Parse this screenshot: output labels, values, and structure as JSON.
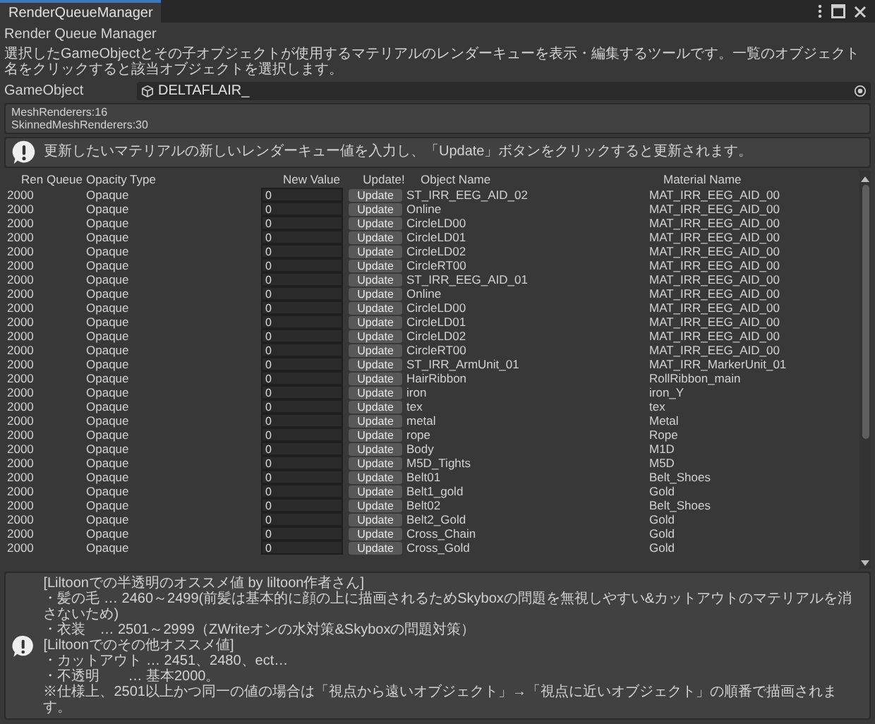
{
  "tabs": [
    {
      "label": "RenderQueueManager",
      "selected": true
    }
  ],
  "title": "Render Queue Manager",
  "description": "選択したGameObjectとその子オブジェクトが使用するマテリアルのレンダーキューを表示・編集するツールです。一覧のオブジェクト名をクリックすると該当オブジェクトを選択します。",
  "gameobject": {
    "label": "GameObject",
    "value": "DELTAFLAIR_"
  },
  "counts": [
    "MeshRenderers:16",
    "SkinnedMeshRenderers:30"
  ],
  "info": "更新したいマテリアルの新しいレンダーキュー値を入力し、「Update」ボタンをクリックすると更新されます。",
  "table": {
    "columns": [
      "Ren Queue",
      "Opacity Type",
      "New Value",
      "Update!",
      "Object Name",
      "Material Name"
    ],
    "rows": [
      {
        "queue": "2000",
        "opacity": "Opaque",
        "new_value": "0",
        "button": "Update",
        "object": "ST_IRR_EEG_AID_02",
        "material": "MAT_IRR_EEG_AID_00"
      },
      {
        "queue": "2000",
        "opacity": "Opaque",
        "new_value": "0",
        "button": "Update",
        "object": "Online",
        "material": "MAT_IRR_EEG_AID_00"
      },
      {
        "queue": "2000",
        "opacity": "Opaque",
        "new_value": "0",
        "button": "Update",
        "object": "CircleLD00",
        "material": "MAT_IRR_EEG_AID_00"
      },
      {
        "queue": "2000",
        "opacity": "Opaque",
        "new_value": "0",
        "button": "Update",
        "object": "CircleLD01",
        "material": "MAT_IRR_EEG_AID_00"
      },
      {
        "queue": "2000",
        "opacity": "Opaque",
        "new_value": "0",
        "button": "Update",
        "object": "CircleLD02",
        "material": "MAT_IRR_EEG_AID_00"
      },
      {
        "queue": "2000",
        "opacity": "Opaque",
        "new_value": "0",
        "button": "Update",
        "object": "CircleRT00",
        "material": "MAT_IRR_EEG_AID_00"
      },
      {
        "queue": "2000",
        "opacity": "Opaque",
        "new_value": "0",
        "button": "Update",
        "object": "ST_IRR_EEG_AID_01",
        "material": "MAT_IRR_EEG_AID_00"
      },
      {
        "queue": "2000",
        "opacity": "Opaque",
        "new_value": "0",
        "button": "Update",
        "object": "Online",
        "material": "MAT_IRR_EEG_AID_00"
      },
      {
        "queue": "2000",
        "opacity": "Opaque",
        "new_value": "0",
        "button": "Update",
        "object": "CircleLD00",
        "material": "MAT_IRR_EEG_AID_00"
      },
      {
        "queue": "2000",
        "opacity": "Opaque",
        "new_value": "0",
        "button": "Update",
        "object": "CircleLD01",
        "material": "MAT_IRR_EEG_AID_00"
      },
      {
        "queue": "2000",
        "opacity": "Opaque",
        "new_value": "0",
        "button": "Update",
        "object": "CircleLD02",
        "material": "MAT_IRR_EEG_AID_00"
      },
      {
        "queue": "2000",
        "opacity": "Opaque",
        "new_value": "0",
        "button": "Update",
        "object": "CircleRT00",
        "material": "MAT_IRR_EEG_AID_00"
      },
      {
        "queue": "2000",
        "opacity": "Opaque",
        "new_value": "0",
        "button": "Update",
        "object": "ST_IRR_ArmUnit_01",
        "material": "MAT_IRR_MarkerUnit_01"
      },
      {
        "queue": "2000",
        "opacity": "Opaque",
        "new_value": "0",
        "button": "Update",
        "object": "HairRibbon",
        "material": "RollRibbon_main"
      },
      {
        "queue": "2000",
        "opacity": "Opaque",
        "new_value": "0",
        "button": "Update",
        "object": "iron",
        "material": "iron_Y"
      },
      {
        "queue": "2000",
        "opacity": "Opaque",
        "new_value": "0",
        "button": "Update",
        "object": "tex",
        "material": "tex"
      },
      {
        "queue": "2000",
        "opacity": "Opaque",
        "new_value": "0",
        "button": "Update",
        "object": "metal",
        "material": "Metal"
      },
      {
        "queue": "2000",
        "opacity": "Opaque",
        "new_value": "0",
        "button": "Update",
        "object": "rope",
        "material": "Rope"
      },
      {
        "queue": "2000",
        "opacity": "Opaque",
        "new_value": "0",
        "button": "Update",
        "object": "Body",
        "material": "M1D"
      },
      {
        "queue": "2000",
        "opacity": "Opaque",
        "new_value": "0",
        "button": "Update",
        "object": "M5D_Tights",
        "material": "M5D"
      },
      {
        "queue": "2000",
        "opacity": "Opaque",
        "new_value": "0",
        "button": "Update",
        "object": "Belt01",
        "material": "Belt_Shoes"
      },
      {
        "queue": "2000",
        "opacity": "Opaque",
        "new_value": "0",
        "button": "Update",
        "object": "Belt1_gold",
        "material": "Gold"
      },
      {
        "queue": "2000",
        "opacity": "Opaque",
        "new_value": "0",
        "button": "Update",
        "object": "Belt02",
        "material": "Belt_Shoes"
      },
      {
        "queue": "2000",
        "opacity": "Opaque",
        "new_value": "0",
        "button": "Update",
        "object": "Belt2_Gold",
        "material": "Gold"
      },
      {
        "queue": "2000",
        "opacity": "Opaque",
        "new_value": "0",
        "button": "Update",
        "object": "Cross_Chain",
        "material": "Gold"
      },
      {
        "queue": "2000",
        "opacity": "Opaque",
        "new_value": "0",
        "button": "Update",
        "object": "Cross_Gold",
        "material": "Gold"
      }
    ]
  },
  "help": [
    "[Liltoonでの半透明のオススメ値 by liltoon作者さん]",
    "・髪の毛 … 2460～2499(前髪は基本的に顔の上に描画されるためSkyboxの問題を無視しやすい&カットアウトのマテリアルを消さないため)",
    "・衣装　… 2501～2999（ZWriteオンの水対策&Skyboxの問題対策）",
    "[Liltoonでのその他オススメ値]",
    "・カットアウト … 2451、2480、ect…",
    "・不透明　　… 基本2000。",
    "※仕様上、2501以上かつ同一の値の場合は「視点から遠いオブジェクト」→「視点に近いオブジェクト」の順番で描画されます。"
  ]
}
